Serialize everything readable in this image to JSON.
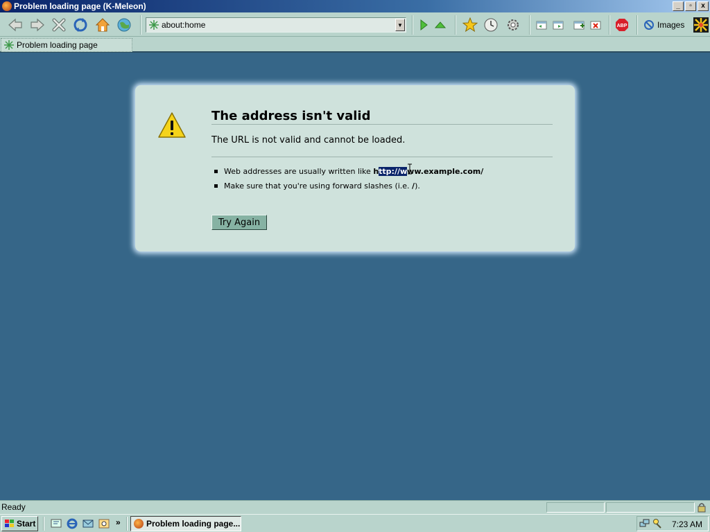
{
  "window": {
    "title": "Problem loading page (K-Meleon)",
    "min": "_",
    "max": "▫",
    "close": "x"
  },
  "toolbar": {
    "url": "about:home",
    "images_label": "Images"
  },
  "tabs": [
    {
      "label": "Problem loading page"
    }
  ],
  "error": {
    "title": "The address isn't valid",
    "description": "The URL is not valid and cannot be loaded.",
    "bullet1_prefix": "Web addresses are usually written like ",
    "bullet1_b1": "h",
    "bullet1_sel": "ttp://w",
    "bullet1_b2": "ww.example.com/",
    "bullet2_prefix": "Make sure that you're using forward slashes (i.e. ",
    "bullet2_slash": "/",
    "bullet2_suffix": ").",
    "try_again": "Try Again"
  },
  "status": {
    "text": "Ready"
  },
  "taskbar": {
    "start": "Start",
    "task_label": "Problem loading page...",
    "clock": "7:23 AM",
    "chevron": "»"
  },
  "colors": {
    "page_bg": "#366688",
    "box_bg": "#cfe2dc",
    "chrome": "#b9d4cc",
    "title_bar": "#0a246a"
  }
}
